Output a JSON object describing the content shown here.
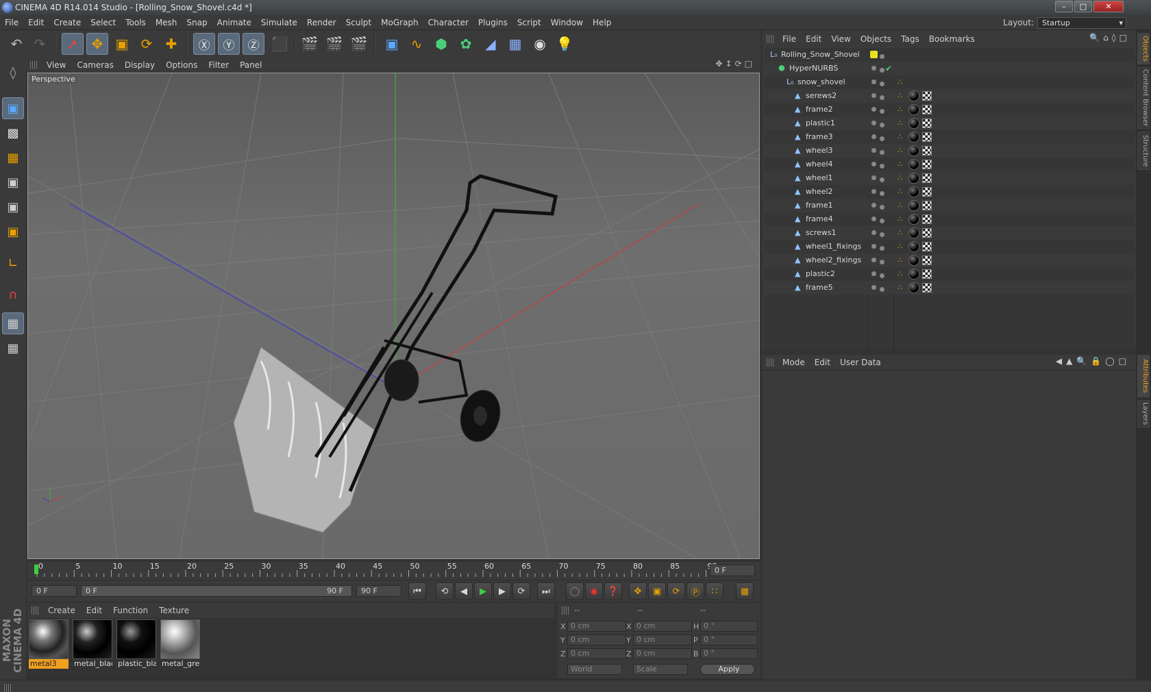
{
  "window": {
    "title": "CINEMA 4D R14.014 Studio - [Rolling_Snow_Shovel.c4d *]",
    "minimize": "–",
    "maximize": "□",
    "close": "✕"
  },
  "menubar": {
    "items": [
      "File",
      "Edit",
      "Create",
      "Select",
      "Tools",
      "Mesh",
      "Snap",
      "Animate",
      "Simulate",
      "Render",
      "Sculpt",
      "MoGraph",
      "Character",
      "Plugins",
      "Script",
      "Window",
      "Help"
    ],
    "layout_label": "Layout:",
    "layout_value": "Startup"
  },
  "viewport": {
    "menu": [
      "View",
      "Cameras",
      "Display",
      "Options",
      "Filter",
      "Panel"
    ],
    "label": "Perspective"
  },
  "timeline": {
    "ticks": [
      "0",
      "5",
      "10",
      "15",
      "20",
      "25",
      "30",
      "35",
      "40",
      "45",
      "50",
      "55",
      "60",
      "65",
      "70",
      "75",
      "80",
      "85",
      "90"
    ],
    "current_frame": "0 F",
    "start_field": "0 F",
    "range_start": "0 F",
    "range_end": "90 F",
    "end_field": "90 F"
  },
  "materials": {
    "menu": [
      "Create",
      "Edit",
      "Function",
      "Texture"
    ],
    "items": [
      {
        "name": "metal3",
        "selected": true
      },
      {
        "name": "metal_black",
        "selected": false
      },
      {
        "name": "plastic_black",
        "selected": false
      },
      {
        "name": "metal_grey",
        "selected": false
      }
    ]
  },
  "coordinates": {
    "headers": [
      "--",
      "--",
      "--"
    ],
    "rows": [
      {
        "a": "X",
        "av": "0 cm",
        "b": "X",
        "bv": "0 cm",
        "c": "H",
        "cv": "0 °"
      },
      {
        "a": "Y",
        "av": "0 cm",
        "b": "Y",
        "bv": "0 cm",
        "c": "P",
        "cv": "0 °"
      },
      {
        "a": "Z",
        "av": "0 cm",
        "b": "Z",
        "bv": "0 cm",
        "c": "B",
        "cv": "0 °"
      }
    ],
    "mode1": "World",
    "mode2": "Scale",
    "apply": "Apply"
  },
  "objects": {
    "menu": [
      "File",
      "Edit",
      "View",
      "Objects",
      "Tags",
      "Bookmarks"
    ],
    "tree": [
      {
        "name": "Rolling_Snow_Shovel",
        "level": 0,
        "kind": "null"
      },
      {
        "name": "HyperNURBS",
        "level": 1,
        "kind": "nurbs"
      },
      {
        "name": "snow_shovel",
        "level": 2,
        "kind": "null"
      },
      {
        "name": "serews2",
        "level": 3,
        "kind": "poly"
      },
      {
        "name": "frame2",
        "level": 3,
        "kind": "poly"
      },
      {
        "name": "plastic1",
        "level": 3,
        "kind": "poly"
      },
      {
        "name": "frame3",
        "level": 3,
        "kind": "poly"
      },
      {
        "name": "wheel3",
        "level": 3,
        "kind": "poly"
      },
      {
        "name": "wheel4",
        "level": 3,
        "kind": "poly"
      },
      {
        "name": "wheel1",
        "level": 3,
        "kind": "poly"
      },
      {
        "name": "wheel2",
        "level": 3,
        "kind": "poly"
      },
      {
        "name": "frame1",
        "level": 3,
        "kind": "poly"
      },
      {
        "name": "frame4",
        "level": 3,
        "kind": "poly"
      },
      {
        "name": "screws1",
        "level": 3,
        "kind": "poly"
      },
      {
        "name": "wheel1_fixings",
        "level": 3,
        "kind": "poly"
      },
      {
        "name": "wheel2_fixings",
        "level": 3,
        "kind": "poly"
      },
      {
        "name": "plastic2",
        "level": 3,
        "kind": "poly"
      },
      {
        "name": "frame5",
        "level": 3,
        "kind": "poly"
      }
    ]
  },
  "attributes": {
    "menu": [
      "Mode",
      "Edit",
      "User Data"
    ]
  },
  "sidetabs": [
    "Objects",
    "Content Browser",
    "Structure",
    "Attributes",
    "Layers"
  ],
  "brand": "MAXON CINEMA 4D",
  "colors": {
    "accent": "#f0a020",
    "selection": "#5a6a7a"
  }
}
